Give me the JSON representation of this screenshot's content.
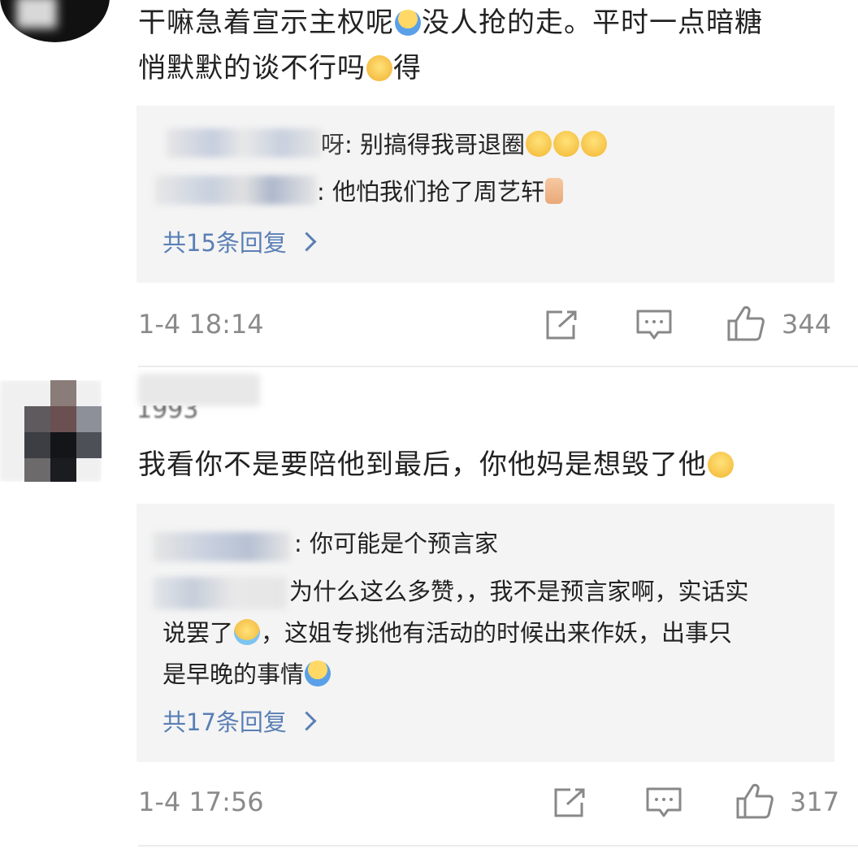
{
  "comments": [
    {
      "username_visible": "",
      "text_line1": "干嘛急着宣示主权呢",
      "text_line1b": "没人抢的走。平时一点暗糖",
      "text_line2": "悄默默的谈不行吗",
      "text_line2b": "得",
      "replies": [
        {
          "name_tail": "呀",
          "text": ": 别搞得我哥退圈",
          "emojis": [
            "smile-emoji",
            "smile-emoji",
            "smile-emoji"
          ]
        },
        {
          "name_tail": "",
          "text": ": 他怕我们抢了周艺轩",
          "emojis": [
            "thumbs-up-emoji"
          ]
        }
      ],
      "more_replies": "共15条回复",
      "time": "1-4 18:14",
      "likes": "344"
    },
    {
      "username_visible": "1993",
      "text": "我看你不是要陪他到最后，你他妈是想毁了他",
      "replies": [
        {
          "name_tail": "",
          "text": ": 你可能是个预言家"
        },
        {
          "name_tail": "",
          "text_line1": "为什么这么多赞，，我不是预言家啊，实话实",
          "text_line2a": "说罢了",
          "text_line2b": "，这姐专挑他有活动的时候出来作妖，出事只",
          "text_line3": "是早晚的事情"
        }
      ],
      "more_replies": "共17条回复",
      "time": "1-4 17:56",
      "likes": "317"
    }
  ],
  "colors": {
    "link": "#5a7fb5",
    "meta": "#8a8a8a",
    "reply_bg": "#f4f4f4",
    "divider": "#ececec"
  },
  "icons": [
    "share-icon",
    "comment-icon",
    "like-icon",
    "chevron-right-icon"
  ]
}
